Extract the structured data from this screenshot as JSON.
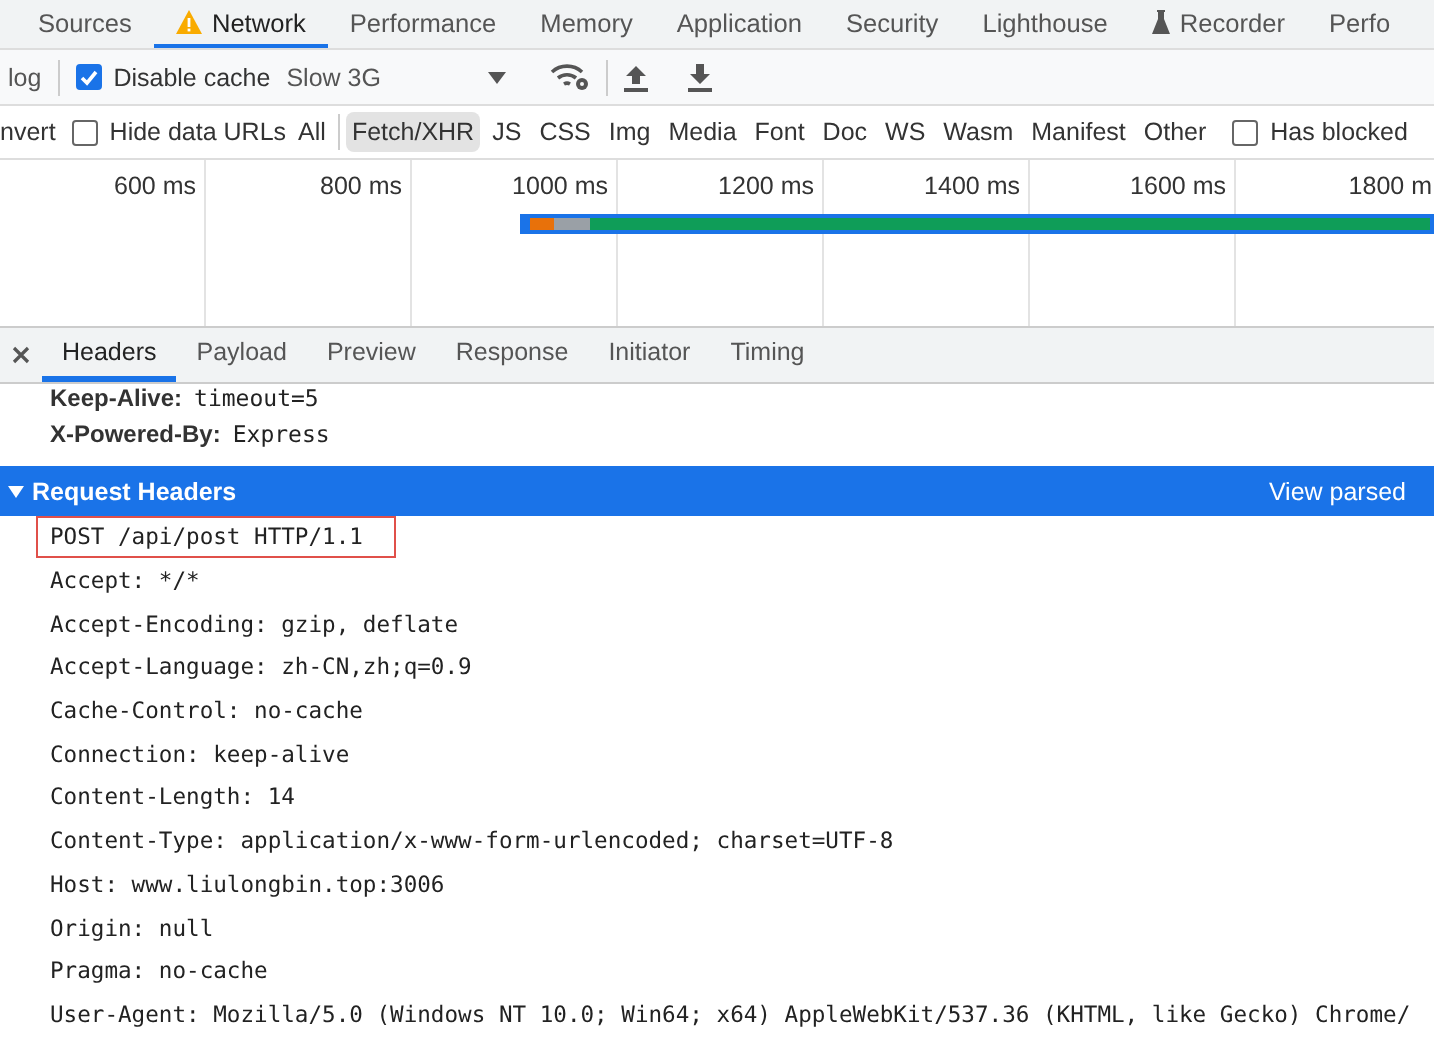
{
  "main_tabs": [
    {
      "label": "Sources",
      "selected": false,
      "kind": "plain"
    },
    {
      "label": "Network",
      "selected": true,
      "kind": "warning"
    },
    {
      "label": "Performance",
      "selected": false,
      "kind": "plain"
    },
    {
      "label": "Memory",
      "selected": false,
      "kind": "plain"
    },
    {
      "label": "Application",
      "selected": false,
      "kind": "plain"
    },
    {
      "label": "Security",
      "selected": false,
      "kind": "plain"
    },
    {
      "label": "Lighthouse",
      "selected": false,
      "kind": "plain"
    },
    {
      "label": "Recorder",
      "selected": false,
      "kind": "experimental"
    },
    {
      "label": "Perfo",
      "selected": false,
      "kind": "plain"
    }
  ],
  "toolbar": {
    "preserve_log_label": "log",
    "disable_cache": {
      "label": "Disable cache",
      "checked": true
    },
    "throttling": "Slow 3G"
  },
  "filter_bar": {
    "invert_label": "nvert",
    "hide_data_urls": {
      "label": "Hide data URLs",
      "checked": false
    },
    "filters": [
      {
        "label": "All",
        "selected": false
      },
      {
        "label": "Fetch/XHR",
        "selected": true
      },
      {
        "label": "JS",
        "selected": false
      },
      {
        "label": "CSS",
        "selected": false
      },
      {
        "label": "Img",
        "selected": false
      },
      {
        "label": "Media",
        "selected": false
      },
      {
        "label": "Font",
        "selected": false
      },
      {
        "label": "Doc",
        "selected": false
      },
      {
        "label": "WS",
        "selected": false
      },
      {
        "label": "Wasm",
        "selected": false
      },
      {
        "label": "Manifest",
        "selected": false
      },
      {
        "label": "Other",
        "selected": false
      }
    ],
    "has_blocked": {
      "label": "Has blocked",
      "checked": false
    }
  },
  "timeline": {
    "ticks": [
      "600 ms",
      "800 ms",
      "1000 ms",
      "1200 ms",
      "1400 ms",
      "1600 ms",
      "1800 m"
    ]
  },
  "detail_tabs": [
    {
      "label": "Headers",
      "selected": true
    },
    {
      "label": "Payload",
      "selected": false
    },
    {
      "label": "Preview",
      "selected": false
    },
    {
      "label": "Response",
      "selected": false
    },
    {
      "label": "Initiator",
      "selected": false
    },
    {
      "label": "Timing",
      "selected": false
    }
  ],
  "response_headers_tail": [
    {
      "name": "Keep-Alive:",
      "value": "timeout=5"
    },
    {
      "name": "X-Powered-By:",
      "value": "Express"
    }
  ],
  "request_headers": {
    "title": "Request Headers",
    "expanded": true,
    "action": "View parsed",
    "lines": [
      {
        "text": "POST /api/post HTTP/1.1",
        "highlighted": true
      },
      {
        "text": "Accept: */*",
        "highlighted": false
      },
      {
        "text": "Accept-Encoding: gzip, deflate",
        "highlighted": false
      },
      {
        "text": "Accept-Language: zh-CN,zh;q=0.9",
        "highlighted": false
      },
      {
        "text": "Cache-Control: no-cache",
        "highlighted": false
      },
      {
        "text": "Connection: keep-alive",
        "highlighted": false
      },
      {
        "text": "Content-Length: 14",
        "highlighted": false
      },
      {
        "text": "Content-Type: application/x-www-form-urlencoded; charset=UTF-8",
        "highlighted": false
      },
      {
        "text": "Host: www.liulongbin.top:3006",
        "highlighted": false
      },
      {
        "text": "Origin: null",
        "highlighted": false
      },
      {
        "text": "Pragma: no-cache",
        "highlighted": false
      },
      {
        "text": "User-Agent: Mozilla/5.0 (Windows NT 10.0; Win64; x64) AppleWebKit/537.36 (KHTML, like Gecko) Chrome/",
        "highlighted": false
      }
    ]
  }
}
